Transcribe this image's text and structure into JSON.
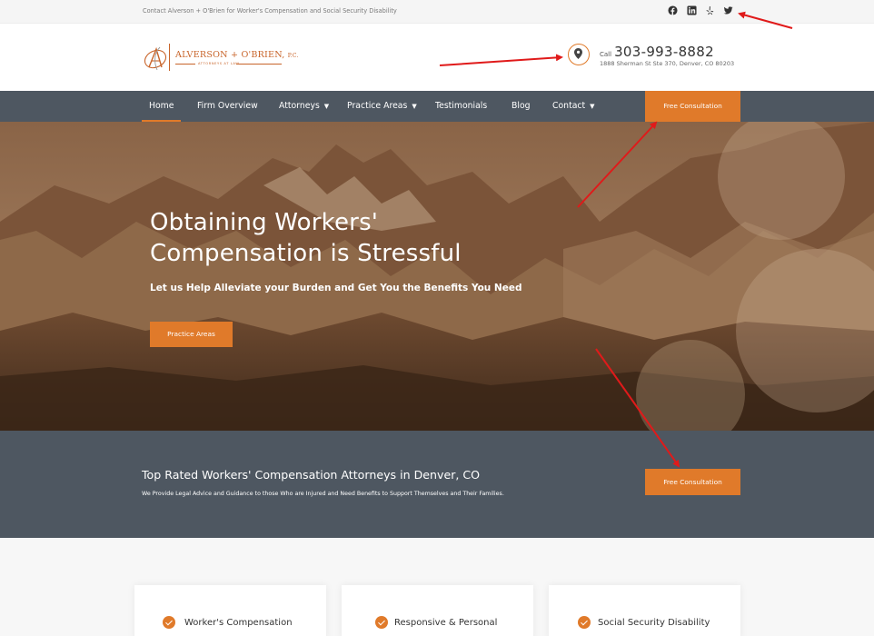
{
  "topbar": {
    "text": "Contact Alverson + O'Brien for Worker's Compensation and Social Security Disability",
    "social": [
      "facebook-icon",
      "linkedin-icon",
      "yelp-icon",
      "twitter-icon"
    ]
  },
  "header": {
    "logo": {
      "name": "ALVERSON + O'BRIEN",
      "suffix": "P.C.",
      "tagline": "ATTORNEYS AT LAW",
      "monogram": "A"
    },
    "call_label": "Call",
    "phone": "303-993-8882",
    "address": "1888 Sherman St Ste 370, Denver, CO 80203"
  },
  "nav": {
    "items": [
      {
        "label": "Home",
        "active": true
      },
      {
        "label": "Firm Overview"
      },
      {
        "label": "Attorneys",
        "dropdown": true
      },
      {
        "label": "Practice Areas",
        "dropdown": true
      },
      {
        "label": "Testimonials"
      },
      {
        "label": "Blog"
      },
      {
        "label": "Contact",
        "dropdown": true
      }
    ],
    "cta": "Free Consultation"
  },
  "hero": {
    "title_line1": "Obtaining Workers'",
    "title_line2": "Compensation is Stressful",
    "subtitle": "Let us Help Alleviate your Burden and Get You the Benefits You Need",
    "button": "Practice Areas"
  },
  "band": {
    "title": "Top Rated Workers' Compensation Attorneys in Denver, CO",
    "subtitle": "We Provide Legal Advice and Guidance to those Who are Injured and Need Benefits to Support Themselves and Their Families.",
    "button": "Free Consultation"
  },
  "cards": [
    {
      "label": "Worker's Compensation"
    },
    {
      "label": "Responsive & Personal"
    },
    {
      "label": "Social Security Disability"
    }
  ],
  "colors": {
    "accent": "#e07a2a",
    "nav_bg": "#4e5761",
    "annotation": "#e01a1a"
  }
}
